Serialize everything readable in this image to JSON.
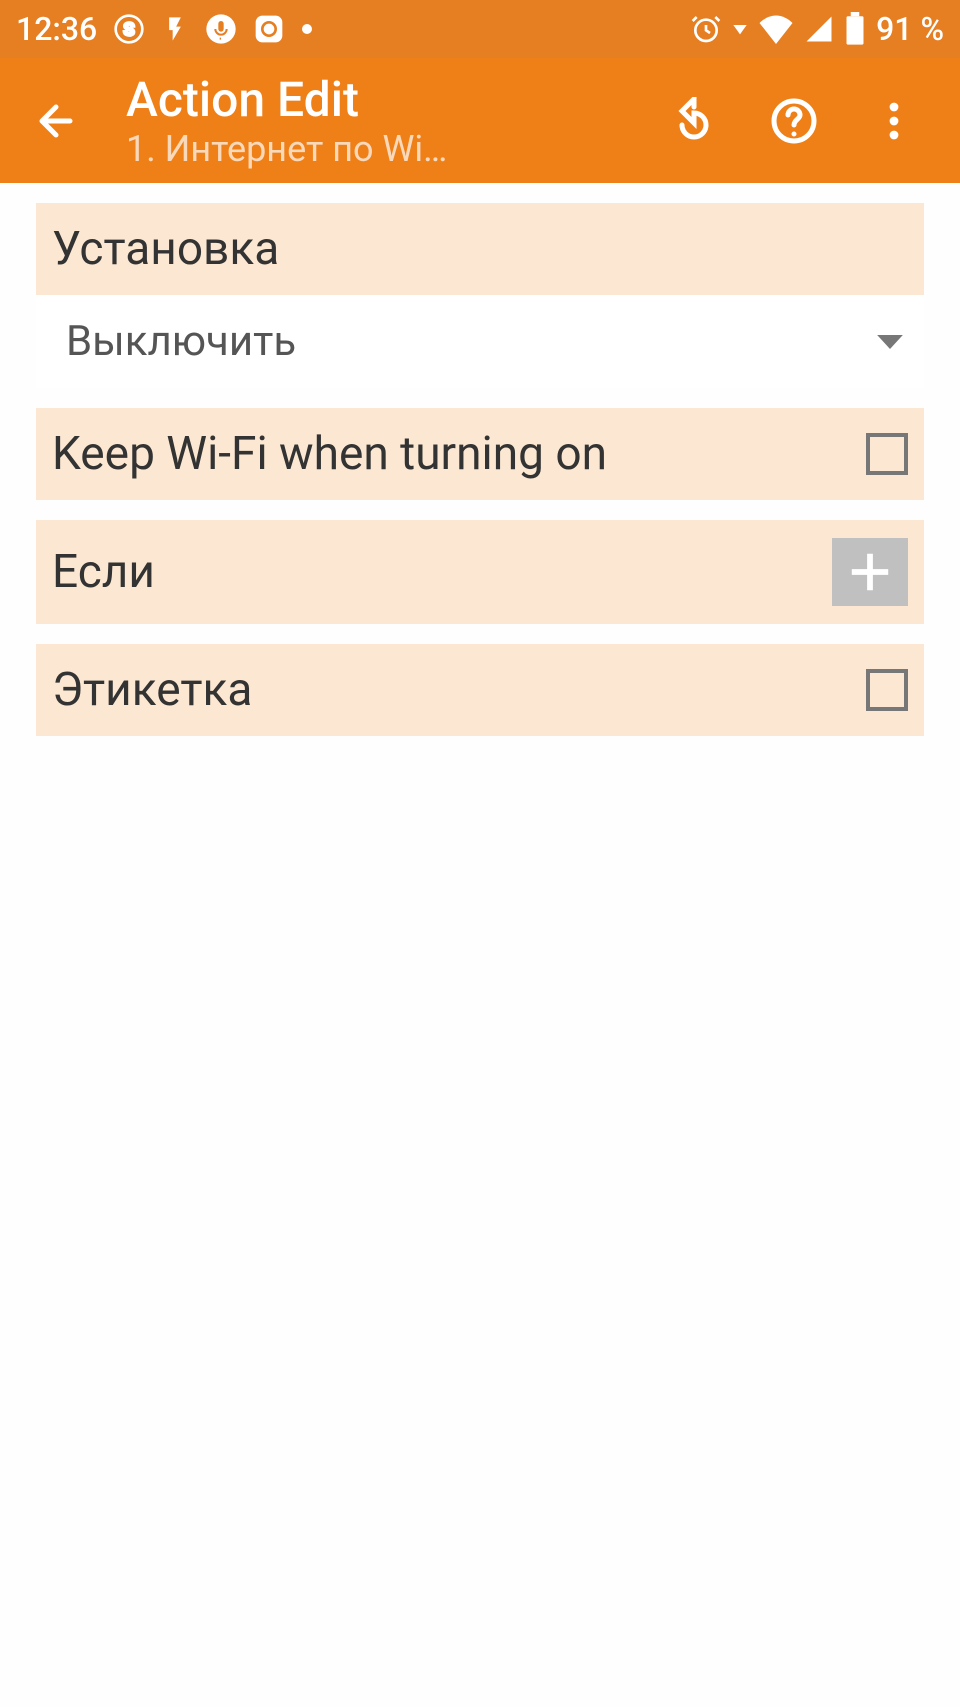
{
  "statusBar": {
    "time": "12:36",
    "battery": "91 %"
  },
  "appBar": {
    "title": "Action Edit",
    "subtitle": "1. Интернет по Wi…"
  },
  "sections": {
    "setup": {
      "title": "Установка",
      "dropdown_value": "Выключить"
    },
    "keepWifi": {
      "title": "Keep Wi-Fi when turning on"
    },
    "if": {
      "title": "Если"
    },
    "label": {
      "title": "Этикетка"
    }
  }
}
